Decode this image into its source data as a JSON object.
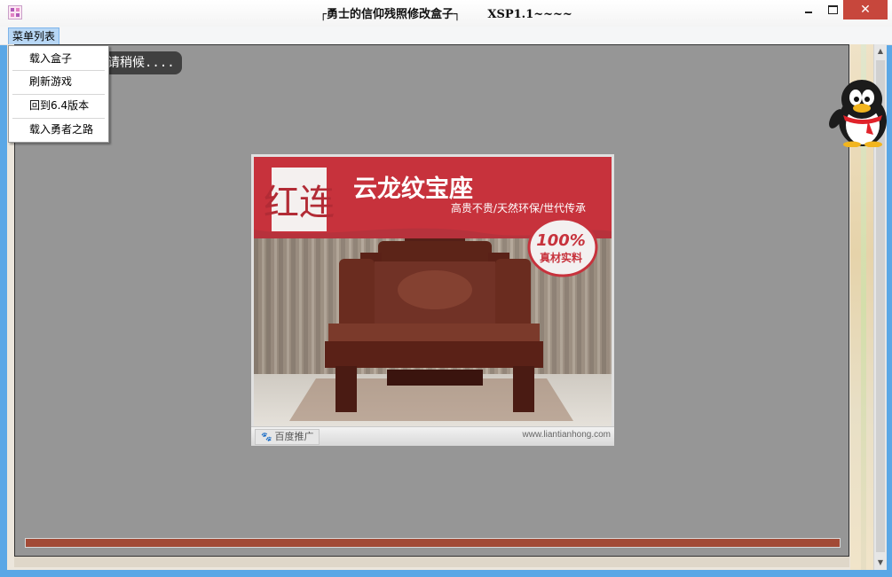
{
  "window": {
    "title": "┌勇士的信仰残照修改盒子┐",
    "version": "XSP1.1~~~~",
    "close_label": "✕"
  },
  "menubar": {
    "menu_label": "菜单列表"
  },
  "dropdown": {
    "items": [
      {
        "label": "载入盒子"
      },
      {
        "label": "刷新游戏"
      },
      {
        "label": "回到6.4版本"
      },
      {
        "label": "载入勇者之路"
      }
    ]
  },
  "loading_text": "请稍候....",
  "ad": {
    "brand_logo": "红连",
    "headline": "云龙纹宝座",
    "tagline": "高贵不贵/天然环保/世代传承",
    "badge_percent": "100%",
    "badge_text": "真材实料",
    "footer_label": "百度推广",
    "url": "www.liantianhong.com"
  },
  "progress": {
    "fraction": 1.0,
    "color": "#a24a36"
  },
  "colors": {
    "close_button": "#c7473c",
    "panel": "#969696",
    "ad_banner": "#c7323c"
  }
}
